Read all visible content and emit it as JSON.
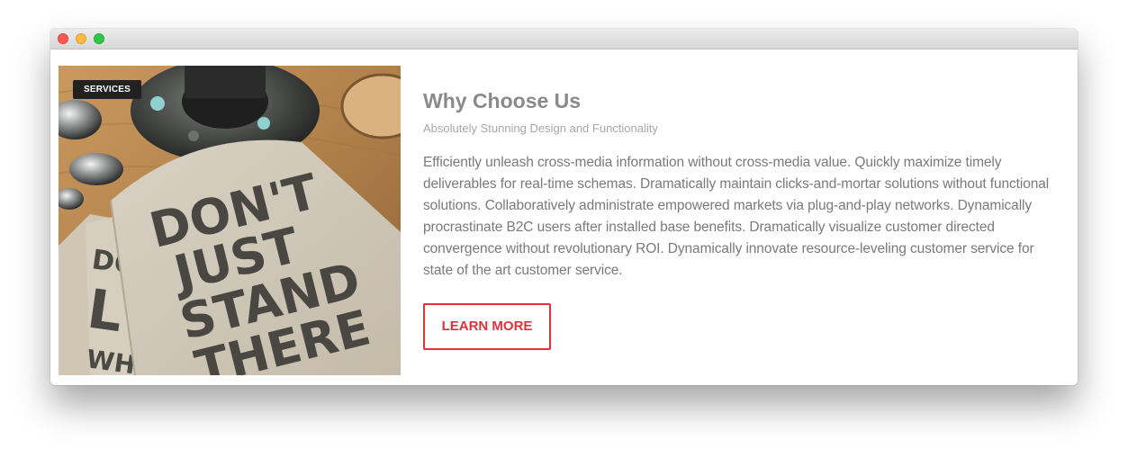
{
  "window": {
    "traffic_lights": [
      "close",
      "minimize",
      "maximize"
    ]
  },
  "card": {
    "badge_label": "SERVICES",
    "image_text": [
      "DON'T",
      "JUST",
      "STAND",
      "THERE"
    ],
    "title": "Why Choose Us",
    "subtitle": "Absolutely Stunning Design and Functionality",
    "body": "Efficiently unleash cross-media information without cross-media value. Quickly maximize timely deliverables for real-time schemas. Dramatically maintain clicks-and-mortar solutions without functional solutions. Collaboratively administrate empowered markets via plug-and-play networks. Dynamically procrastinate B2C users after installed base benefits. Dramatically visualize customer directed convergence without revolutionary ROI. Dynamically innovate resource-leveling customer service for state of the art customer service.",
    "cta_label": "LEARN MORE"
  },
  "colors": {
    "accent": "#e0313c",
    "title": "#8a8a8a",
    "subtitle": "#a8a8a8",
    "body": "#7a7a7a",
    "badge_bg": "#222222"
  }
}
